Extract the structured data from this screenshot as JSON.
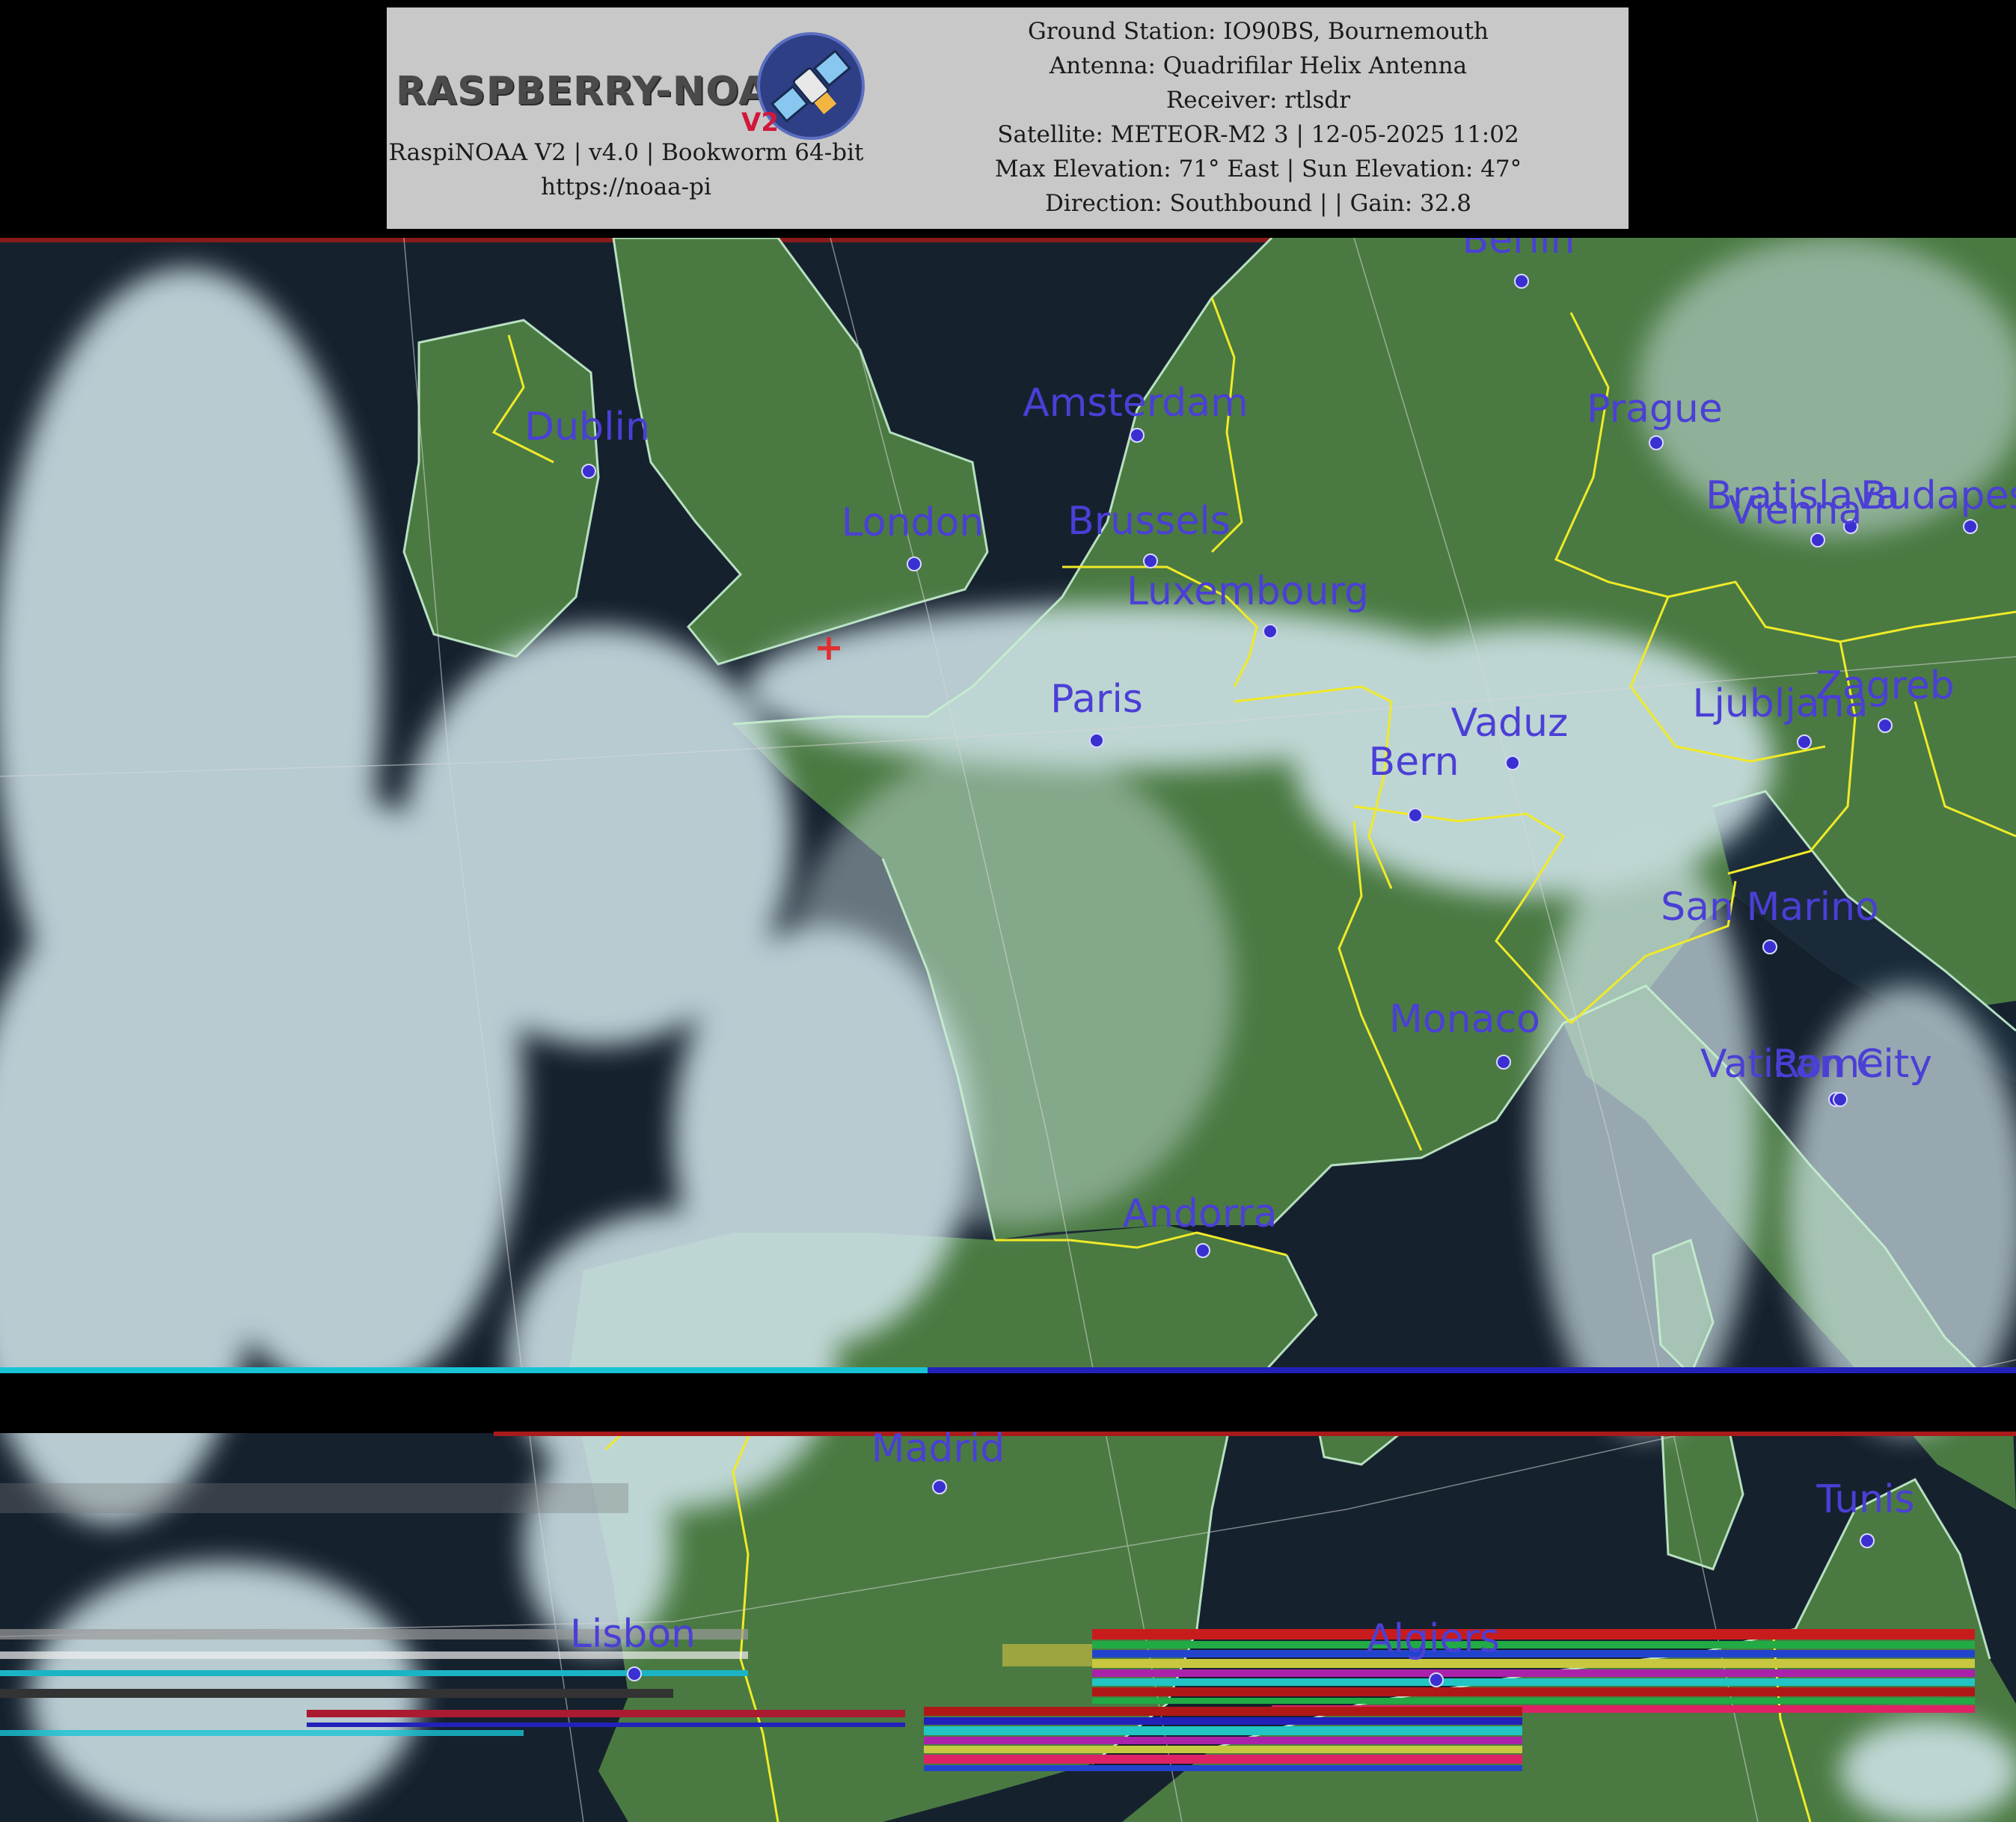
{
  "header": {
    "logo_text": "RASPBERRY-NOAA",
    "logo_badge": "V2",
    "software_line": "RaspiNOAA V2 | v4.0 | Bookworm 64-bit",
    "url_line": "https://noaa-pi",
    "ground_station": "Ground Station: IO90BS, Bournemouth",
    "antenna": "Antenna: Quadrifilar Helix Antenna",
    "receiver": "Receiver: rtlsdr",
    "satellite": "Satellite: METEOR-M2 3 | 12-05-2025 11:02",
    "elevation": "Max Elevation: 71° East | Sun Elevation: 47°",
    "direction": "Direction: Southbound | | Gain: 32.8"
  },
  "map": {
    "colors": {
      "sea": "#16212e",
      "land": "#4a7a42",
      "cloud": "#cfe3e8",
      "border": "#f0ea28",
      "coast": "#c6f0d0",
      "city": "#4b3fd6"
    },
    "cities": [
      {
        "name": "Berlin"
      },
      {
        "name": "Amsterdam"
      },
      {
        "name": "Prague"
      },
      {
        "name": "Dublin"
      },
      {
        "name": "London"
      },
      {
        "name": "Brussels"
      },
      {
        "name": "Bratislava"
      },
      {
        "name": "Vienna"
      },
      {
        "name": "Budapest"
      },
      {
        "name": "Luxembourg"
      },
      {
        "name": "Paris"
      },
      {
        "name": "Vaduz"
      },
      {
        "name": "Ljubljana"
      },
      {
        "name": "Zagreb"
      },
      {
        "name": "Bern"
      },
      {
        "name": "San Marino"
      },
      {
        "name": "Monaco"
      },
      {
        "name": "Vatican City"
      },
      {
        "name": "Rome"
      },
      {
        "name": "Andorra"
      },
      {
        "name": "Madrid"
      },
      {
        "name": "Tunis"
      },
      {
        "name": "Lisbon"
      },
      {
        "name": "Algiers"
      }
    ],
    "ground_station_marker": "+"
  }
}
